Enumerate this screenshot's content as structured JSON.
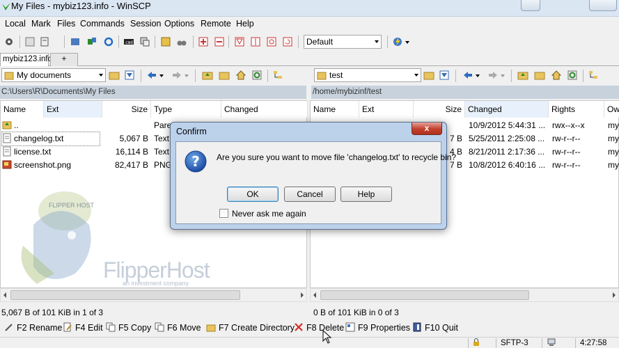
{
  "window": {
    "title": "My Files - mybiz123.info - WinSCP"
  },
  "menu": [
    "Local",
    "Mark",
    "Files",
    "Commands",
    "Session",
    "Options",
    "Remote",
    "Help"
  ],
  "toolbar": {
    "transfer_settings": "Default"
  },
  "tabs": {
    "session": "mybiz123.info",
    "new": "+"
  },
  "left": {
    "location": "My documents",
    "path": "C:\\Users\\R\\Documents\\My Files",
    "columns": [
      "Name",
      "Ext",
      "Size",
      "Type",
      "Changed"
    ],
    "rows": [
      {
        "name": "..",
        "size": "",
        "type": "Pare..."
      },
      {
        "name": "changelog.txt",
        "size": "5,067 B",
        "type": "Text"
      },
      {
        "name": "license.txt",
        "size": "16,114 B",
        "type": "Text"
      },
      {
        "name": "screenshot.png",
        "size": "82,417 B",
        "type": "PNG"
      }
    ],
    "status": "5,067 B of 101 KiB in 1 of 3"
  },
  "right": {
    "location": "test",
    "path": "/home/mybizinf/test",
    "columns": [
      "Name",
      "Ext",
      "Size",
      "Changed",
      "Rights",
      "Ow"
    ],
    "rows": [
      {
        "size": "",
        "changed": "10/9/2012 5:44:31 ...",
        "rights": "rwx--x--x",
        "owner": "my"
      },
      {
        "size": "7 B",
        "changed": "5/25/2011 2:25:08 ...",
        "rights": "rw-r--r--",
        "owner": "my"
      },
      {
        "size": "4 B",
        "changed": "8/21/2011 2:17:36 ...",
        "rights": "rw-r--r--",
        "owner": "my"
      },
      {
        "size": "7 B",
        "changed": "10/8/2012 6:40:16 ...",
        "rights": "rw-r--r--",
        "owner": "my"
      }
    ],
    "status": "0 B of 101 KiB in 0 of 3"
  },
  "fkeys": [
    "F2 Rename",
    "F4 Edit",
    "F5 Copy",
    "F6 Move",
    "F7 Create Directory",
    "F8 Delete",
    "F9 Properties",
    "F10 Quit"
  ],
  "bottom": {
    "protocol": "SFTP-3",
    "time": "4:27:58"
  },
  "watermark": {
    "brand": "FlipperHost",
    "tagline": "an investment company",
    "badge": "FLIPPER HOST"
  },
  "dialog": {
    "title": "Confirm",
    "close": "x",
    "message": "Are you sure you want to move file 'changelog.txt' to recycle bin?",
    "ok": "OK",
    "cancel": "Cancel",
    "help": "Help",
    "never_ask": "Never ask me again"
  },
  "colors": {
    "title_bar": "#dbe6f3",
    "path_bar": "#c7d2dd",
    "dialog_frame": "#bcd1ea",
    "close_button": "#c0402d"
  }
}
